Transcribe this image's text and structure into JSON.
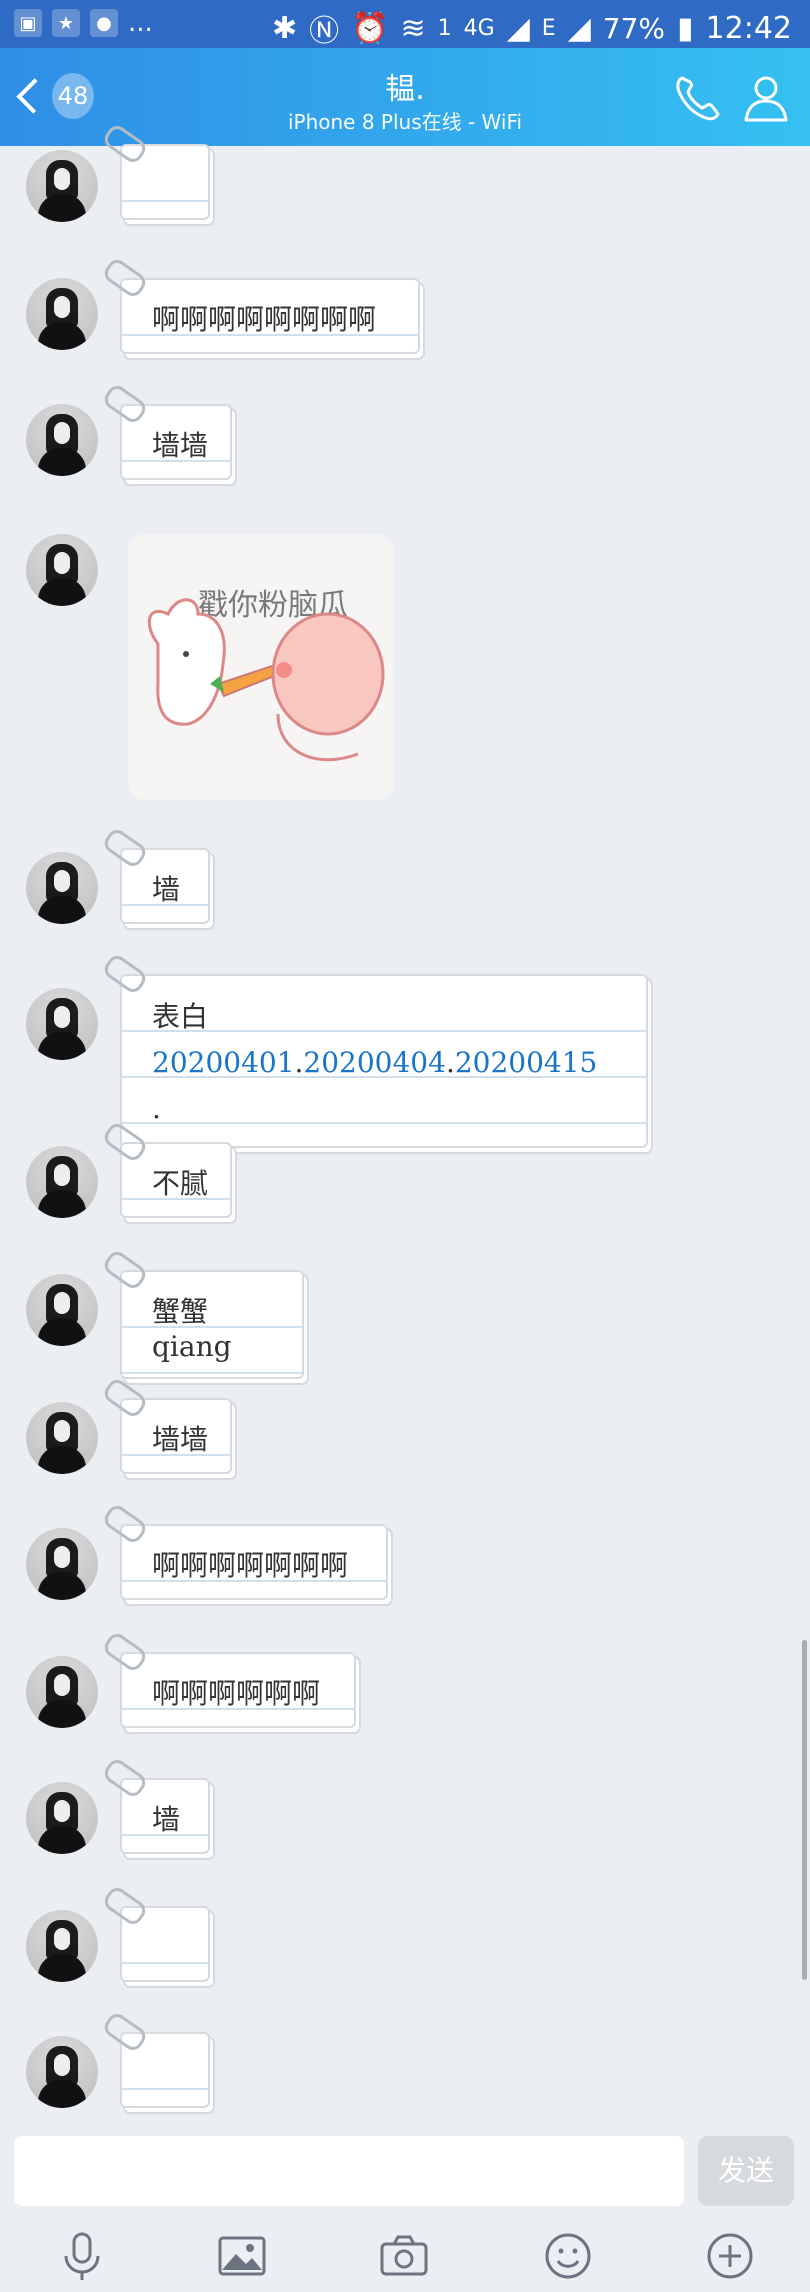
{
  "status_bar": {
    "battery": "77%",
    "time": "12:42",
    "network_4g": "4G",
    "network_e": "E",
    "sim_badge": "1",
    "more": "..."
  },
  "header": {
    "back_count": "48",
    "title": "韫.",
    "subtitle": "iPhone 8 Plus在线 - WiFi",
    "call_icon": "phone-icon",
    "profile_icon": "person-icon"
  },
  "messages": [
    {
      "type": "text",
      "text": ""
    },
    {
      "type": "text",
      "text": "啊啊啊啊啊啊啊啊"
    },
    {
      "type": "text",
      "text": "墙墙"
    },
    {
      "type": "image",
      "caption": "戳你粉脑瓜"
    },
    {
      "type": "text",
      "text": "墙"
    },
    {
      "type": "text",
      "prefix": "表白",
      "links": [
        "20200401",
        "20200404",
        "20200415"
      ],
      "link_sep": ".",
      "suffix": "."
    },
    {
      "type": "text",
      "text": "不腻"
    },
    {
      "type": "text",
      "text": "蟹蟹qiang"
    },
    {
      "type": "text",
      "text": "墙墙"
    },
    {
      "type": "text",
      "text": "啊啊啊啊啊啊啊"
    },
    {
      "type": "text",
      "text": "啊啊啊啊啊啊"
    },
    {
      "type": "text",
      "text": "墙"
    },
    {
      "type": "text",
      "text": ""
    },
    {
      "type": "text",
      "text": ""
    }
  ],
  "input": {
    "placeholder": "",
    "send_label": "发送"
  },
  "toolbar": {
    "items": [
      "microphone-icon",
      "image-icon",
      "camera-icon",
      "emoji-icon",
      "plus-icon"
    ]
  },
  "colors": {
    "header_start": "#2f8ee6",
    "header_end": "#35c1f1",
    "background": "#ebeff4",
    "link": "#1a75c9"
  }
}
